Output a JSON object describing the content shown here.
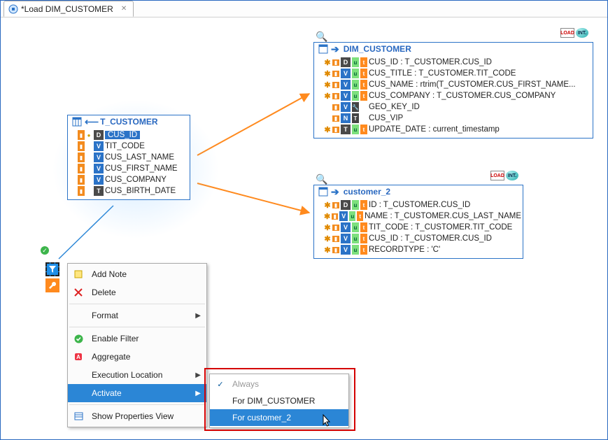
{
  "tabs": [
    {
      "title": "*Load DIM_CUSTOMER"
    }
  ],
  "source_node": {
    "title": "T_CUSTOMER",
    "columns": [
      {
        "name": "CUS_ID",
        "type": "D",
        "selected": true
      },
      {
        "name": "TIT_CODE",
        "type": "V"
      },
      {
        "name": "CUS_LAST_NAME",
        "type": "V"
      },
      {
        "name": "CUS_FIRST_NAME",
        "type": "V"
      },
      {
        "name": "CUS_COMPANY",
        "type": "V"
      },
      {
        "name": "CUS_BIRTH_DATE",
        "type": "T"
      }
    ]
  },
  "target_node_1": {
    "title": "DIM_CUSTOMER",
    "rows": [
      {
        "type": "D",
        "name": "CUS_ID",
        "expr": "CUS_ID : T_CUSTOMER.CUS_ID"
      },
      {
        "type": "V",
        "name": "CUS_TITLE",
        "expr": "CUS_TITLE : T_CUSTOMER.TIT_CODE"
      },
      {
        "type": "V",
        "name": "CUS_NAME",
        "expr": "CUS_NAME : rtrim(T_CUSTOMER.CUS_FIRST_NAME..."
      },
      {
        "type": "V",
        "name": "CUS_COMPANY",
        "expr": "CUS_COMPANY : T_CUSTOMER.CUS_COMPANY"
      },
      {
        "type": "V",
        "name": "GEO_KEY_ID",
        "expr": "GEO_KEY_ID",
        "wrench": true
      },
      {
        "type": "N",
        "name": "CUS_VIP",
        "expr": "CUS_VIP"
      },
      {
        "type": "T",
        "name": "UPDATE_DATE",
        "expr": "UPDATE_DATE : current_timestamp"
      }
    ]
  },
  "target_node_2": {
    "title": "customer_2",
    "rows": [
      {
        "type": "D",
        "name": "ID",
        "expr": "ID : T_CUSTOMER.CUS_ID"
      },
      {
        "type": "V",
        "name": "NAME",
        "expr": "NAME : T_CUSTOMER.CUS_LAST_NAME"
      },
      {
        "type": "V",
        "name": "TIT_CODE",
        "expr": "TIT_CODE : T_CUSTOMER.TIT_CODE"
      },
      {
        "type": "V",
        "name": "CUS_ID",
        "expr": "CUS_ID : T_CUSTOMER.CUS_ID"
      },
      {
        "type": "V",
        "name": "RECORDTYPE",
        "expr": "RECORDTYPE : 'C'"
      }
    ]
  },
  "mini_badges": {
    "load_label": "LOAD",
    "int_label": "INT."
  },
  "context_menu": {
    "items": [
      {
        "key": "add-note",
        "label": "Add Note"
      },
      {
        "key": "delete",
        "label": "Delete"
      },
      {
        "key": "format",
        "label": "Format",
        "submenu": true
      },
      {
        "key": "enable-filter",
        "label": "Enable Filter"
      },
      {
        "key": "aggregate",
        "label": "Aggregate"
      },
      {
        "key": "exec-loc",
        "label": "Execution Location",
        "submenu": true
      },
      {
        "key": "activate",
        "label": "Activate",
        "submenu": true,
        "highlight": true
      },
      {
        "key": "props",
        "label": "Show Properties View"
      }
    ],
    "activate_submenu": [
      {
        "label": "Always",
        "checked": true,
        "disabled": true
      },
      {
        "label": "For DIM_CUSTOMER"
      },
      {
        "label": "For customer_2",
        "highlight": true
      }
    ]
  }
}
